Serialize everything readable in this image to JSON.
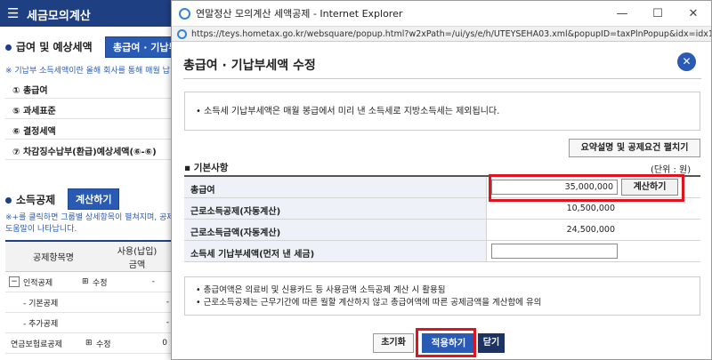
{
  "background": {
    "app_title": "세금모의계산",
    "section1_title": "급여 및 예상세액",
    "section1_button": "총급여 · 기납부",
    "section1_note": "※ 기납부 소득세액이란 올해 회사를 통해 매월 납",
    "summary_rows": [
      "① 총급여",
      "⑤ 과세표준",
      "⑥ 결정세액",
      "⑦ 차감징수납부(환급)예상세액(⑥-⑥)"
    ],
    "section2_title": "소득공제",
    "section2_button": "계산하기",
    "section2_note1": "※+를 클릭하면 그룹별 상세항목이 펼쳐지며, 공제",
    "section2_note2": "도움말이 나타납니다.",
    "table_headers": [
      "공제항목명",
      "사용(납입)\n금액"
    ],
    "table_rows": [
      {
        "name": "인적공제",
        "action": "수정",
        "value": "-"
      },
      {
        "name": "- 기본공제",
        "action": "",
        "value": "-"
      },
      {
        "name": "- 추가공제",
        "action": "",
        "value": "-"
      },
      {
        "name": "연금보험료공제",
        "action": "수정",
        "value": "0"
      }
    ]
  },
  "window": {
    "title": "연말정산 모의계산 세액공제 - Internet Explorer",
    "url": "https://teys.hometax.go.kr/websquare/popup.html?w2xPath=/ui/ys/e/h/UTEYSEHA03.xml&popupID=taxPlnPopup&idx=idx10_1579051876"
  },
  "dialog": {
    "title": "총급여 · 기납부세액 수정",
    "info_text": "소득세 기납부세액은 매월 봉급에서 미리 낸 소득세로 지방소득세는 제외됩니다.",
    "explain_button": "요약설명 및 공제요건 펼치기",
    "section_label": "기본사항",
    "unit": "(단위 : 원)",
    "rows": [
      {
        "label": "총급여",
        "value": "35,000,000",
        "button": "계산하기"
      },
      {
        "label": "근로소득공제(자동계산)",
        "value": "10,500,000"
      },
      {
        "label": "근로소득금액(자동계산)",
        "value": "24,500,000"
      },
      {
        "label": "소득세 기납부세액(먼저 낸 세금)",
        "value": ""
      }
    ],
    "notes": [
      "총급여액은 의료비 및 신용카드 등 사용금액 소득공제 계산 시 활용됨",
      "근로소득공제는 근무기간에 따른 월할 계산하지 않고 총급여액에 따른 공제금액을 계산함에 유의"
    ],
    "reset_button": "초기화",
    "apply_button": "적용하기",
    "close_button": "닫기"
  },
  "colors": {
    "accent": "#2a5bb4",
    "highlight": "#e0141e",
    "header": "#1f3f83"
  }
}
